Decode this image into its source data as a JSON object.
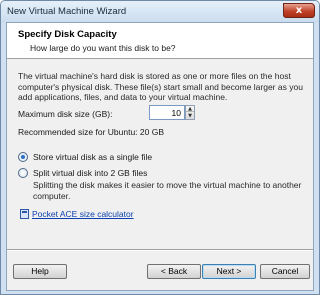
{
  "window": {
    "title": "New Virtual Machine Wizard",
    "close_glyph": "x",
    "close_icon": "close-icon"
  },
  "header": {
    "title": "Specify Disk Capacity",
    "subtitle": "How large do you want this disk to be?"
  },
  "description": "The virtual machine's hard disk is stored as one or more files on the host computer's physical disk. These file(s) start small and become larger as you add applications, files, and data to your virtual machine.",
  "disk_size": {
    "label": "Maximum disk size (GB):",
    "value": "10",
    "spin_up_glyph": "▲",
    "spin_down_glyph": "▼"
  },
  "recommended": "Recommended size for Ubuntu: 20 GB",
  "options": {
    "single": {
      "label": "Store virtual disk as a single file",
      "selected": true
    },
    "split": {
      "label": "Split virtual disk into 2 GB files",
      "selected": false
    },
    "split_description": "Splitting the disk makes it easier to move the virtual machine to another computer."
  },
  "calculator_link": {
    "label": "Pocket ACE size calculator",
    "icon": "calculator-icon"
  },
  "buttons": {
    "help": "Help",
    "back": "< Back",
    "next": "Next >",
    "cancel": "Cancel"
  },
  "colors": {
    "frame": "#cfe0f0",
    "link": "#0b3fae",
    "close": "#c0442a"
  }
}
